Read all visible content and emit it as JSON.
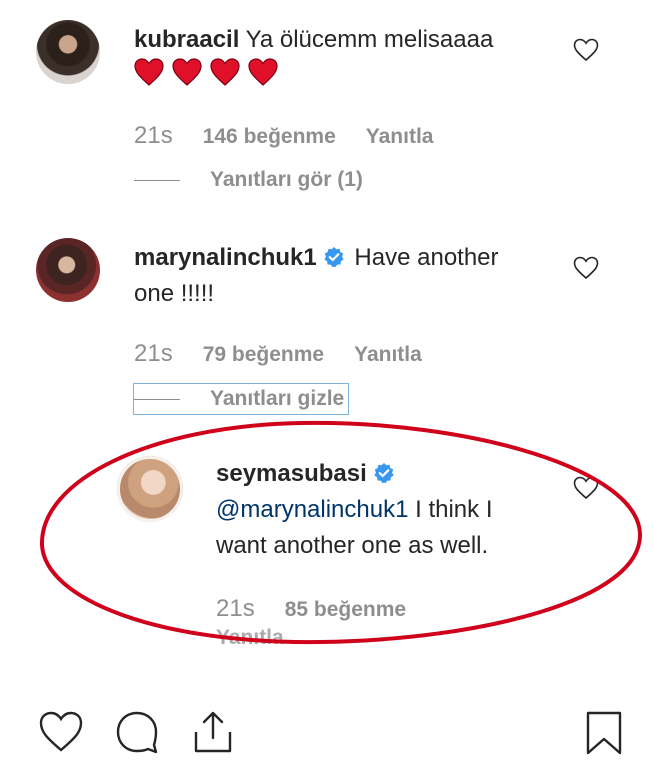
{
  "comments": [
    {
      "username": "kubraacil",
      "text": "Ya ölücemm melisaaaa",
      "emoji_hearts": 4,
      "time": "21s",
      "likes": "146 beğenme",
      "reply": "Yanıtla",
      "replies_toggle": "Yanıtları gör (1)"
    },
    {
      "username": "marynalinchuk1",
      "verified": true,
      "text_line1": "Have another",
      "text_line2": "one !!!!!",
      "time": "21s",
      "likes": "79 beğenme",
      "reply": "Yanıtla",
      "replies_toggle": "Yanıtları gizle"
    }
  ],
  "reply": {
    "username": "seymasubasi",
    "verified": true,
    "mention": "@marynalinchuk1",
    "text_line1": " I think I",
    "text_line2": "want another one as well.",
    "time": "21s",
    "likes": "85 beğenme",
    "reply": "Yanıtla"
  },
  "colors": {
    "annotation_ellipse": "#d0021b",
    "verified_badge": "#3897f0",
    "heart_emoji": "#e0102a",
    "secondary_text": "#8e8e8e"
  },
  "icons": [
    "heart-icon",
    "comment-icon",
    "share-icon",
    "bookmark-icon",
    "verified-badge-icon"
  ]
}
